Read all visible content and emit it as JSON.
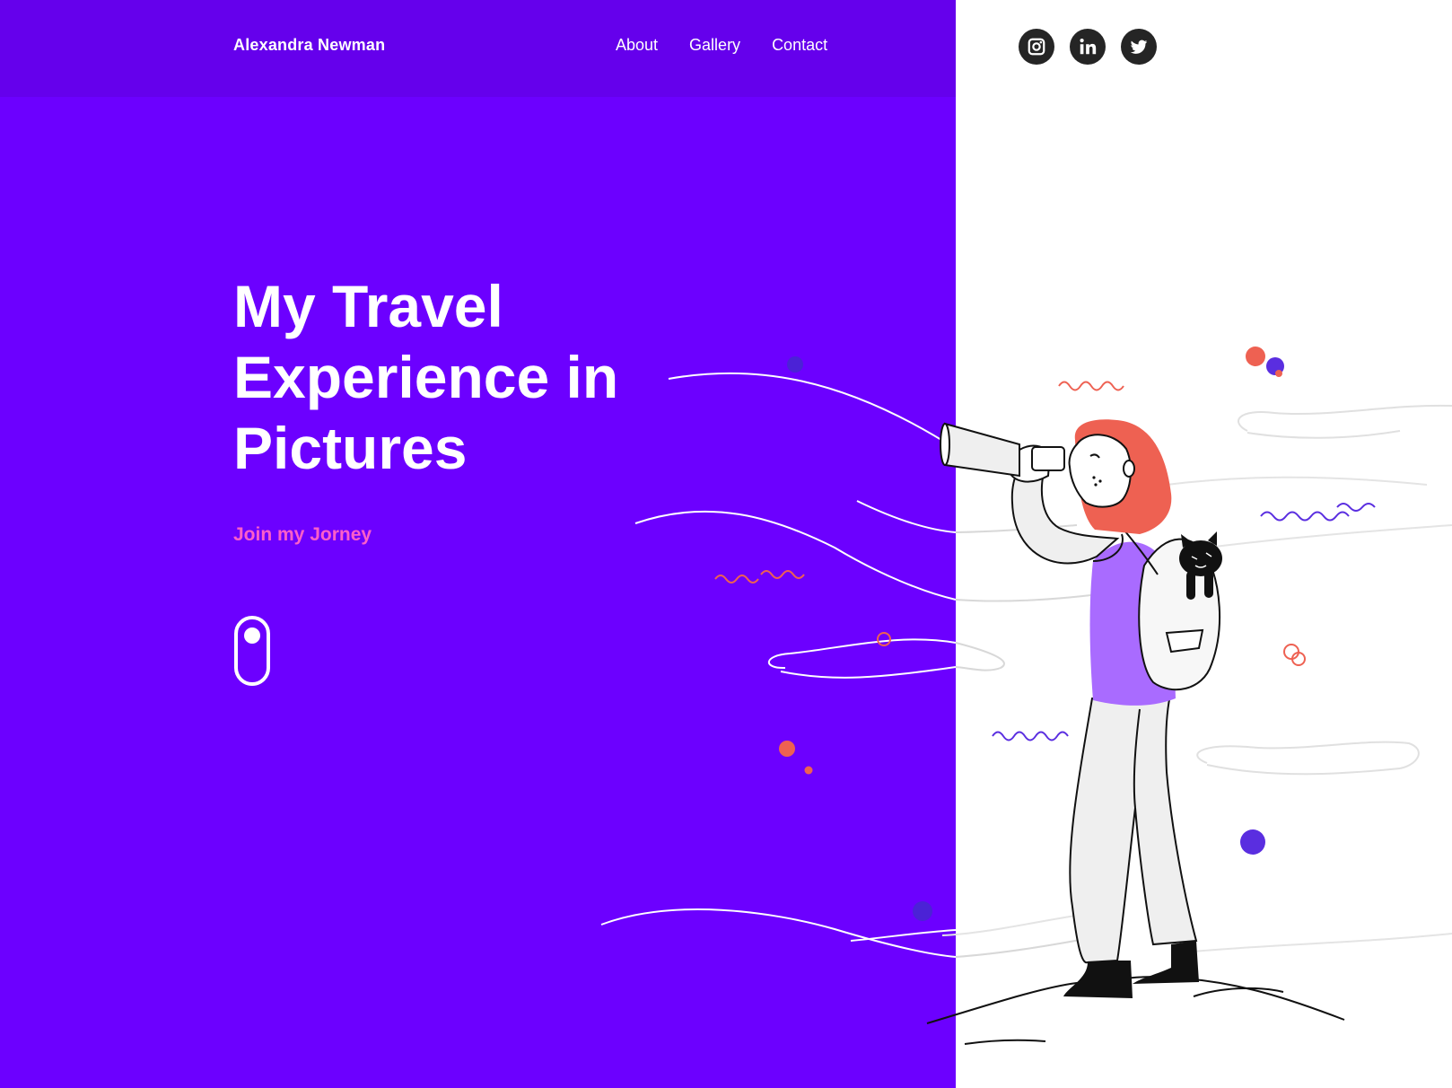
{
  "header": {
    "brand": "Alexandra Newman",
    "nav": [
      "About",
      "Gallery",
      "Contact"
    ]
  },
  "socials": [
    {
      "icon": "instagram-icon"
    },
    {
      "icon": "linkedin-icon"
    },
    {
      "icon": "twitter-icon"
    }
  ],
  "hero": {
    "title_lines": [
      "My Travel",
      "Experience in",
      "Pictures"
    ],
    "cta": "Join my Jorney"
  },
  "colors": {
    "primary": "#6c00ff",
    "header": "#6500ec",
    "accent_pink": "#ff5fc8",
    "coral": "#ee6152",
    "violet": "#5a2ee0",
    "social_bg": "#252525"
  }
}
